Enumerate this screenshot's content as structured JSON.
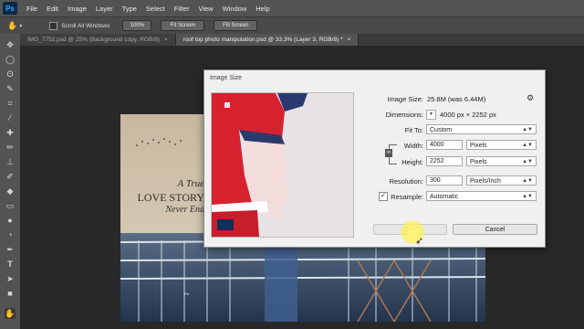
{
  "app": {
    "logo": "Ps"
  },
  "menu": [
    "File",
    "Edit",
    "Image",
    "Layer",
    "Type",
    "Select",
    "Filter",
    "View",
    "Window",
    "Help"
  ],
  "options_bar": {
    "hand_icon": "hand-icon",
    "scroll_all_label": "Scroll All Windows",
    "btn_100": "100%",
    "btn_fit": "Fit Screen",
    "btn_fill": "Fill Screen"
  },
  "tabs": [
    {
      "label": "IMG_7752.psd @ 25% (Background copy, RGB/8)",
      "close": "×"
    },
    {
      "label": "roof top photo manipulation.psd @ 33.3% (Layer 3, RGB/8) *",
      "close": "×"
    }
  ],
  "tools": [
    "move-tool-icon",
    "marquee-tool-icon",
    "lasso-tool-icon",
    "quick-select-tool-icon",
    "crop-tool-icon",
    "eyedropper-tool-icon",
    "healing-brush-icon",
    "brush-tool-icon",
    "clone-stamp-icon",
    "history-brush-icon",
    "eraser-tool-icon",
    "gradient-tool-icon",
    "blur-tool-icon",
    "dodge-tool-icon",
    "pen-tool-icon",
    "type-tool-icon",
    "path-select-icon",
    "shape-tool-icon",
    "hand-tool-icon"
  ],
  "photo_text": {
    "line1": "A True",
    "line2": "LOVE STORY",
    "line3": "Never End"
  },
  "dialog": {
    "title": "Image Size",
    "image_size_label": "Image Size:",
    "image_size_value": "25.8M (was 6.44M)",
    "dimensions_label": "Dimensions:",
    "dimensions_value": "4000 px  ×  2252 px",
    "fit_to_label": "Fit To:",
    "fit_to_value": "Custom",
    "width_label": "Width:",
    "width_value": "4000",
    "width_unit": "Pixels",
    "height_label": "Height:",
    "height_value": "2252",
    "height_unit": "Pixels",
    "resolution_label": "Resolution:",
    "resolution_value": "300",
    "resolution_unit": "Pixels/Inch",
    "resample_label": "Resample:",
    "resample_checked": "✓",
    "resample_value": "Automatic",
    "ok_label": "OK",
    "cancel_label": "Cancel"
  }
}
